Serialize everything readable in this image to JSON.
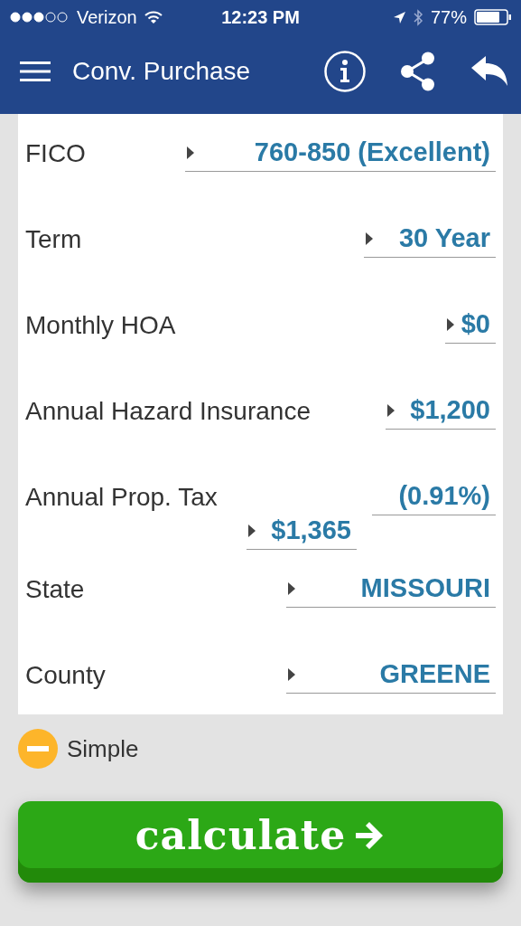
{
  "status_bar": {
    "carrier": "Verizon",
    "time": "12:23 PM",
    "battery": "77%"
  },
  "header": {
    "title": "Conv. Purchase"
  },
  "fields": [
    {
      "label": "FICO",
      "inputs": [
        {
          "value": "760-850 (Excellent)",
          "caret": true
        }
      ]
    },
    {
      "label": "Term",
      "inputs": [
        {
          "value": "30 Year",
          "caret": true
        }
      ]
    },
    {
      "label": "Monthly HOA",
      "inputs": [
        {
          "value": "$0",
          "caret": true
        }
      ]
    },
    {
      "label": "Annual Hazard Insurance",
      "inputs": [
        {
          "value": "$1,200",
          "caret": true
        }
      ]
    },
    {
      "label": "Annual Prop. Tax",
      "inputs": [
        {
          "value": "(0.91%)",
          "caret": false
        },
        {
          "value": "$1,365",
          "caret": true
        }
      ]
    },
    {
      "label": "State",
      "inputs": [
        {
          "value": "MISSOURI",
          "caret": true
        }
      ]
    },
    {
      "label": "County",
      "inputs": [
        {
          "value": "GREENE",
          "caret": true
        }
      ]
    }
  ],
  "mode_toggle": {
    "label": "Simple",
    "expanded": true
  },
  "calculate_button": {
    "label": "calculate"
  }
}
